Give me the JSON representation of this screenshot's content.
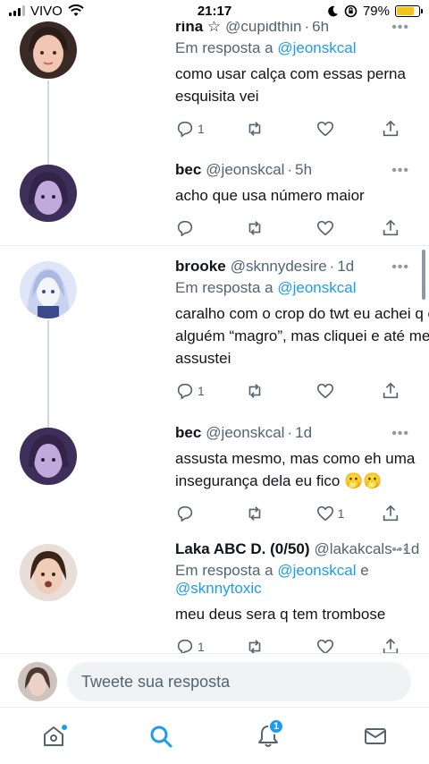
{
  "status_bar": {
    "carrier": "VIVO",
    "time": "21:17",
    "battery": "79%"
  },
  "tweets": [
    {
      "name": "rina ☆",
      "handle": "@cupidthin",
      "time": "6h",
      "reply_prefix": "Em resposta a",
      "reply_to": "@jeonskcal",
      "text": "como usar calça com essas perna esquisita vei",
      "reply_count": "1",
      "like_count": "",
      "avatar_colors": [
        "#f1c6b3",
        "#5a3b2e"
      ]
    },
    {
      "name": "bec",
      "handle": "@jeonskcal",
      "time": "5h",
      "text": "acho que usa número maior",
      "reply_count": "",
      "like_count": "",
      "avatar_colors": [
        "#7b5fb5",
        "#2a1f3d"
      ]
    },
    {
      "name": "brooke",
      "handle": "@sknnydesire",
      "time": "1d",
      "reply_prefix": "Em resposta a",
      "reply_to": "@jeonskcal",
      "text": "caralho com o crop do twt eu achei q era alguém “magro”, mas cliquei e até me assustei",
      "reply_count": "1",
      "like_count": "",
      "avatar_colors": [
        "#b9c6e8",
        "#3b4a8a"
      ]
    },
    {
      "name": "bec",
      "handle": "@jeonskcal",
      "time": "1d",
      "text": "assusta mesmo, mas como eh uma insegurança dela eu fico 🫢🫢",
      "reply_count": "",
      "like_count": "1",
      "avatar_colors": [
        "#7b5fb5",
        "#2a1f3d"
      ]
    },
    {
      "name": "Laka ABC D. (0/50)",
      "handle": "@lakakcals",
      "time": "1d",
      "reply_prefix": "Em resposta a",
      "reply_to": "@jeonskcal",
      "reply_join": "e",
      "reply_to_2": "@sknnytoxic",
      "text": "meu deus sera q tem trombose",
      "reply_count": "1",
      "like_count": "",
      "avatar_colors": [
        "#f0cdb8",
        "#6b4330"
      ]
    }
  ],
  "reply_bar": {
    "placeholder": "Tweete sua resposta"
  },
  "tab_bar": {
    "items": [
      "home-icon",
      "search-icon",
      "notifications-icon",
      "messages-icon"
    ],
    "notifications_badge": "1",
    "accent": "#1d9bf0"
  },
  "colors": {
    "link": "#1d9bf0",
    "muted": "#536471",
    "text": "#0f1419"
  }
}
